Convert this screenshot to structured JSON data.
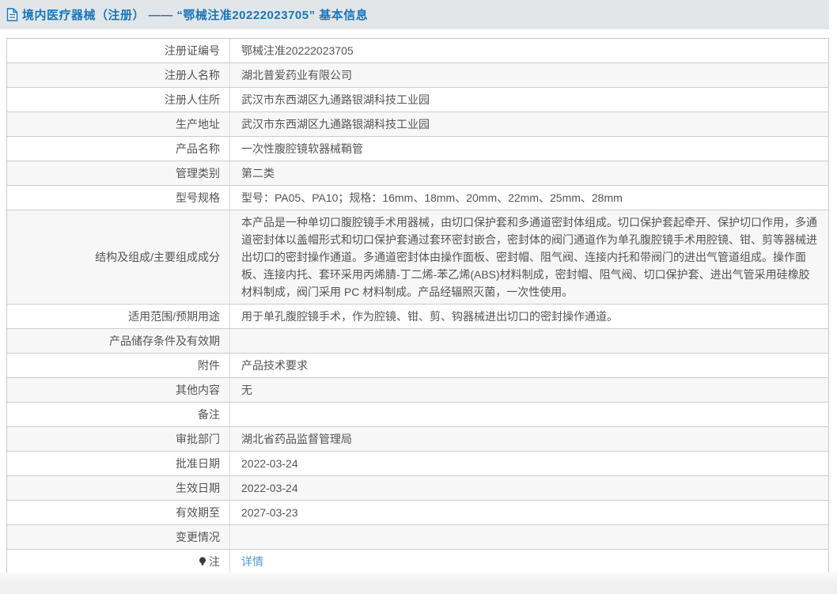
{
  "header": {
    "title": "境内医疗器械（注册） —— “鄂械注准20222023705” 基本信息"
  },
  "colors": {
    "header_bg": "#e2e6e9",
    "header_text": "#1a75bc",
    "row_alt_bg": "#f7f7f8",
    "border": "#cccccc",
    "text": "#555555",
    "link": "#4f9bd5"
  },
  "icons": {
    "header_icon": "document-icon",
    "note_icon": "lightbulb-icon"
  },
  "table": {
    "rows": [
      {
        "label": "注册证编号",
        "value": "鄂械注准20222023705"
      },
      {
        "label": "注册人名称",
        "value": "湖北普爱药业有限公司"
      },
      {
        "label": "注册人住所",
        "value": "武汉市东西湖区九通路银湖科技工业园"
      },
      {
        "label": "生产地址",
        "value": "武汉市东西湖区九通路银湖科技工业园"
      },
      {
        "label": "产品名称",
        "value": "一次性腹腔镜软器械鞘管"
      },
      {
        "label": "管理类别",
        "value": "第二类"
      },
      {
        "label": "型号规格",
        "value": "型号：PA05、PA10；规格：16mm、18mm、20mm、22mm、25mm、28mm"
      },
      {
        "label": "结构及组成/主要组成成分",
        "value": "本产品是一种单切口腹腔镜手术用器械，由切口保护套和多通道密封体组成。切口保护套起牵开、保护切口作用，多通道密封体以盖帽形式和切口保护套通过套环密封嵌合，密封体的阀门通道作为单孔腹腔镜手术用腔镜、钳、剪等器械进出切口的密封操作通道。多通道密封体由操作面板、密封帽、阻气阀、连接内托和带阀门的进出气管道组成。操作面板、连接内托、套环采用丙烯腈-丁二烯-苯乙烯(ABS)材料制成，密封帽、阻气阀、切口保护套、进出气管采用硅橡胶材料制成，阀门采用 PC 材料制成。产品经辐照灭菌，一次性使用。"
      },
      {
        "label": "适用范围/预期用途",
        "value": "用于单孔腹腔镜手术，作为腔镜、钳、剪、钩器械进出切口的密封操作通道。"
      },
      {
        "label": "产品储存条件及有效期",
        "value": ""
      },
      {
        "label": "附件",
        "value": "产品技术要求"
      },
      {
        "label": "其他内容",
        "value": "无"
      },
      {
        "label": "备注",
        "value": ""
      },
      {
        "label": "审批部门",
        "value": "湖北省药品监督管理局"
      },
      {
        "label": "批准日期",
        "value": "2022-03-24"
      },
      {
        "label": "生效日期",
        "value": "2022-03-24"
      },
      {
        "label": "有效期至",
        "value": "2027-03-23"
      },
      {
        "label": "变更情况",
        "value": ""
      },
      {
        "label": "注",
        "value": "详情"
      }
    ]
  }
}
